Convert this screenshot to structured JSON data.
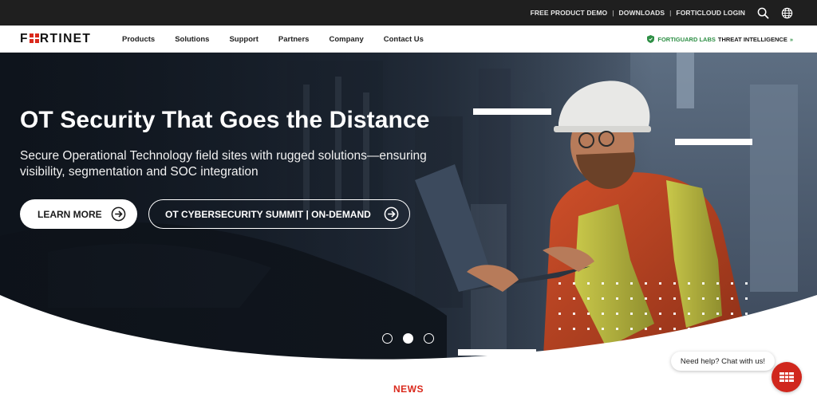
{
  "top_utility": {
    "links": [
      "FREE PRODUCT DEMO",
      "DOWNLOADS",
      "FORTICLOUD LOGIN"
    ],
    "separator": "|",
    "icons": [
      "search-icon",
      "globe-icon"
    ]
  },
  "navbar": {
    "logo": "FORTINET",
    "items": [
      "Products",
      "Solutions",
      "Support",
      "Partners",
      "Company",
      "Contact Us"
    ],
    "fortiguard": {
      "prefix": "FORTIGUARD LABS",
      "label": "THREAT INTELLIGENCE",
      "suffix": "»"
    }
  },
  "hero": {
    "title": "OT Security That Goes the Distance",
    "subtitle": "Secure Operational Technology field sites with rugged solutions—ensuring visibility, segmentation and SOC integration",
    "primary_button": "LEARN MORE",
    "secondary_button": "OT CYBERSECURITY SUMMIT | ON-DEMAND",
    "carousel": {
      "count": 3,
      "active": 2
    }
  },
  "news_heading": "NEWS",
  "chat": {
    "bubble": "Need help? Chat with us!"
  },
  "colors": {
    "topbar_bg": "#1f1f1f",
    "brand_red": "#da291c",
    "fortiguard_green": "#2e8f45",
    "hero_overlay": "#1c2738"
  }
}
